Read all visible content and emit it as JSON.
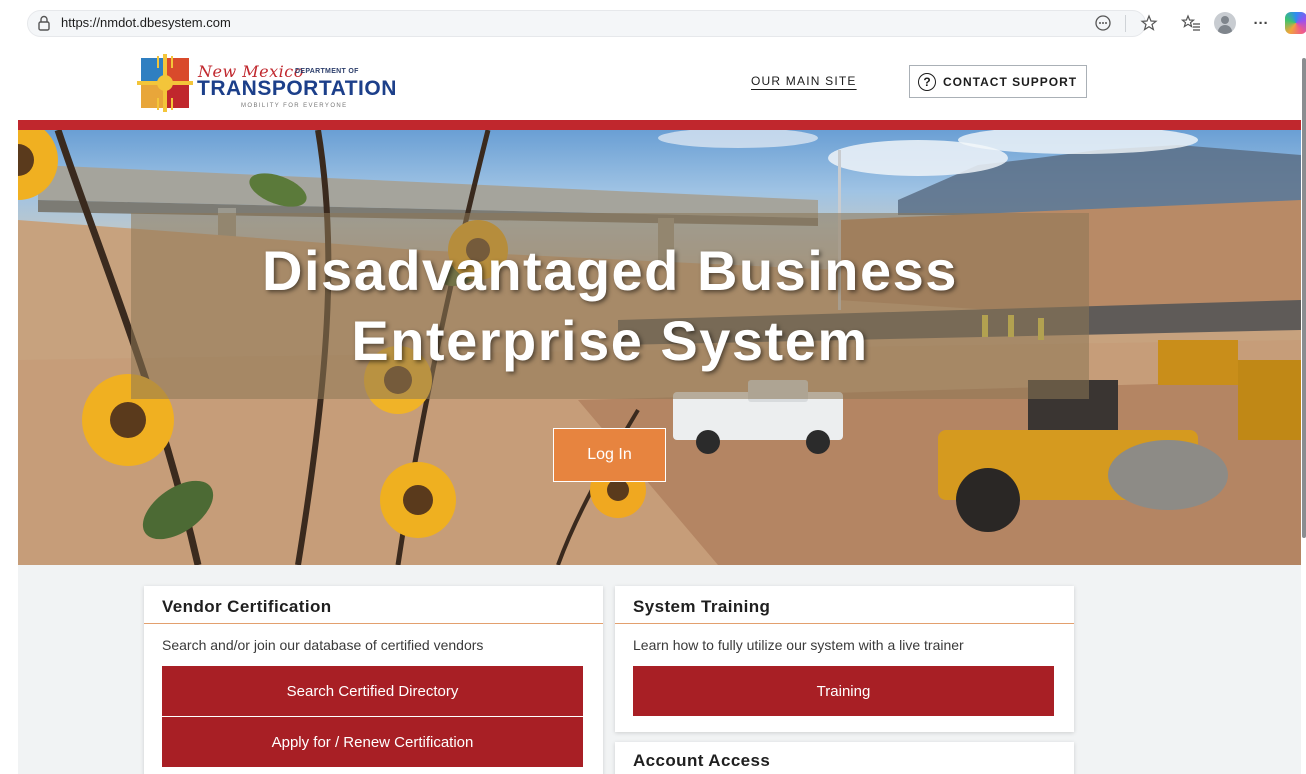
{
  "browser": {
    "url": "https://nmdot.dbesystem.com",
    "icons": [
      "lock-icon",
      "reader-mode-icon",
      "favorite-star-icon",
      "favorites-list-icon",
      "profile-avatar-icon",
      "more-menu-icon",
      "copilot-icon"
    ],
    "more_label": "···"
  },
  "header": {
    "logo": {
      "new_mexico": "New Mexico",
      "department_of": "DEPARTMENT OF",
      "transportation": "TRANSPORTATION",
      "tagline": "MOBILITY FOR EVERYONE"
    },
    "nav_main_site": "OUR MAIN SITE",
    "contact_support": "CONTACT SUPPORT",
    "contact_icon_glyph": "?"
  },
  "hero": {
    "title_line1": "Disadvantaged Business",
    "title_line2": "Enterprise System",
    "login_label": "Log In"
  },
  "cards": {
    "vendor": {
      "title": "Vendor Certification",
      "description": "Search and/or join our database of certified vendors",
      "buttons": [
        "Search Certified Directory",
        "Apply for / Renew Certification"
      ]
    },
    "training": {
      "title": "System Training",
      "description": "Learn how to fully utilize our system with a live trainer",
      "button": "Training"
    },
    "account": {
      "title": "Account Access"
    }
  },
  "colors": {
    "brand_red": "#c0272d",
    "button_red": "#a81f25",
    "login_orange": "#e7843f",
    "card_rule": "#e3a06e",
    "logo_blue": "#1c3f8a"
  }
}
